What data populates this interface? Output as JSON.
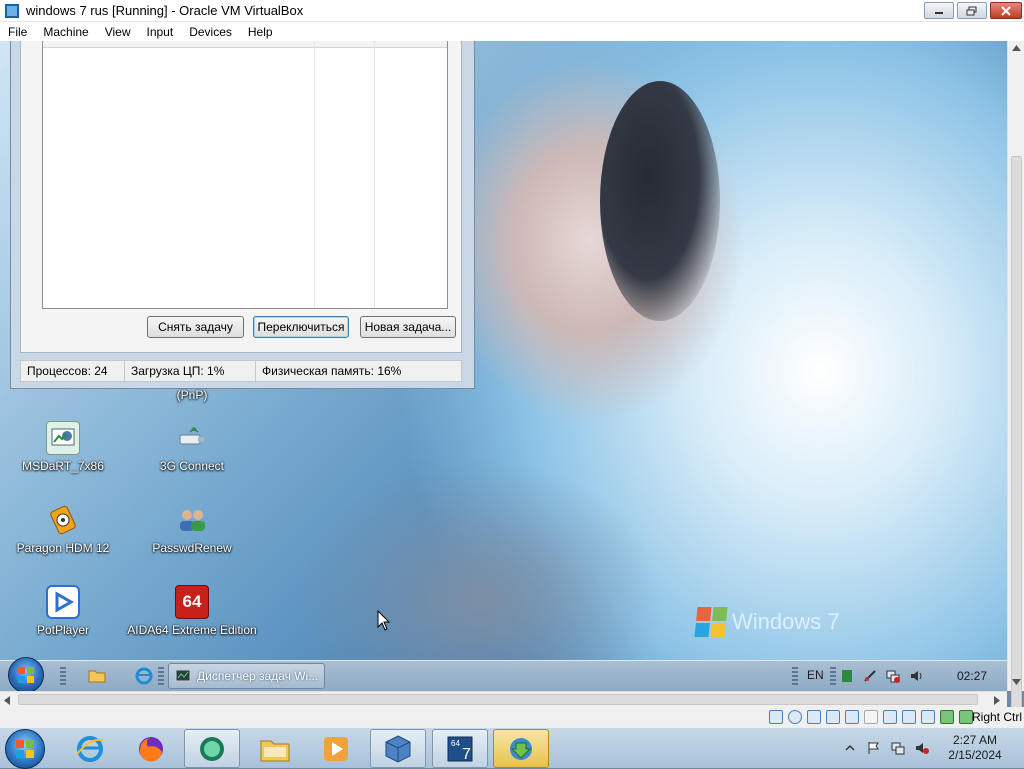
{
  "window": {
    "title": "windows 7 rus [Running] - Oracle VM VirtualBox",
    "menu": [
      "File",
      "Machine",
      "View",
      "Input",
      "Devices",
      "Help"
    ]
  },
  "task_manager": {
    "buttons": {
      "end_task": "Снять задачу",
      "switch_to": "Переключиться",
      "new_task": "Новая задача..."
    },
    "status": {
      "processes": "Процессов: 24",
      "cpu": "Загрузка ЦП: 1%",
      "memory": "Физическая память: 16%"
    }
  },
  "desktop": {
    "icons": [
      {
        "label": "(PnP)",
        "icon": "pnp-icon"
      },
      {
        "label": "MSDaRT_7x86",
        "icon": "msdart-icon"
      },
      {
        "label": "3G Connect",
        "icon": "3g-connect-icon"
      },
      {
        "label": "Paragon HDM 12",
        "icon": "paragon-icon"
      },
      {
        "label": "PasswdRenew",
        "icon": "users-icon"
      },
      {
        "label": "PotPlayer",
        "icon": "potplayer-icon"
      },
      {
        "label": "AIDA64 Extreme Edition",
        "icon": "aida64-icon",
        "badge": "64"
      }
    ],
    "wallpaper_text": "Windows 7"
  },
  "guest_taskbar": {
    "task_label": "Диспетчер задач Wi...",
    "language": "EN",
    "clock": "02:27"
  },
  "vbox_status": {
    "host_key": "Right Ctrl"
  },
  "host_taskbar": {
    "time": "2:27 AM",
    "date": "2/15/2024"
  }
}
